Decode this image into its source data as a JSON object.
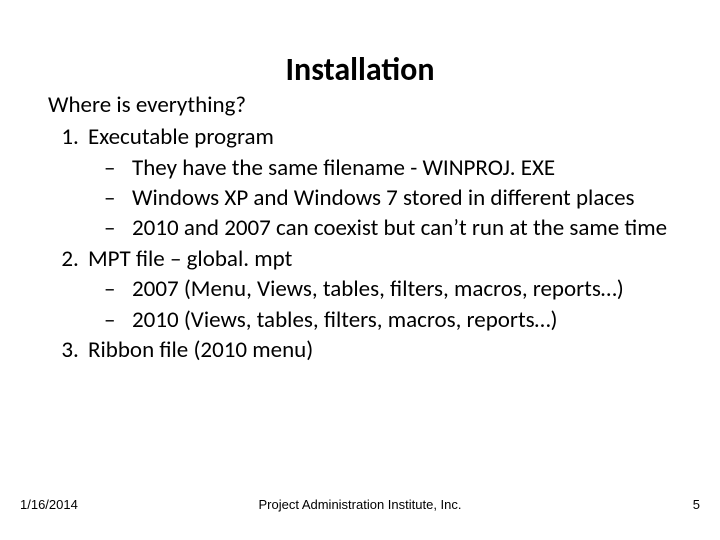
{
  "title": "Installation",
  "lead": "Where is everything?",
  "items": [
    {
      "text": "Executable program",
      "sub": [
        "They have the same filename - WINPROJ. EXE",
        "Windows XP and Windows 7 stored in different places",
        "2010 and 2007 can coexist but can’t run at the same time"
      ]
    },
    {
      "text": "MPT file – global. mpt",
      "sub": [
        "2007 (Menu, Views, tables, filters, macros, reports…)",
        "2010 (Views, tables, filters, macros, reports…)"
      ]
    },
    {
      "text": "Ribbon file (2010 menu)",
      "sub": []
    }
  ],
  "footer": {
    "date": "1/16/2014",
    "center": "Project Administration Institute, Inc.",
    "page": "5"
  }
}
